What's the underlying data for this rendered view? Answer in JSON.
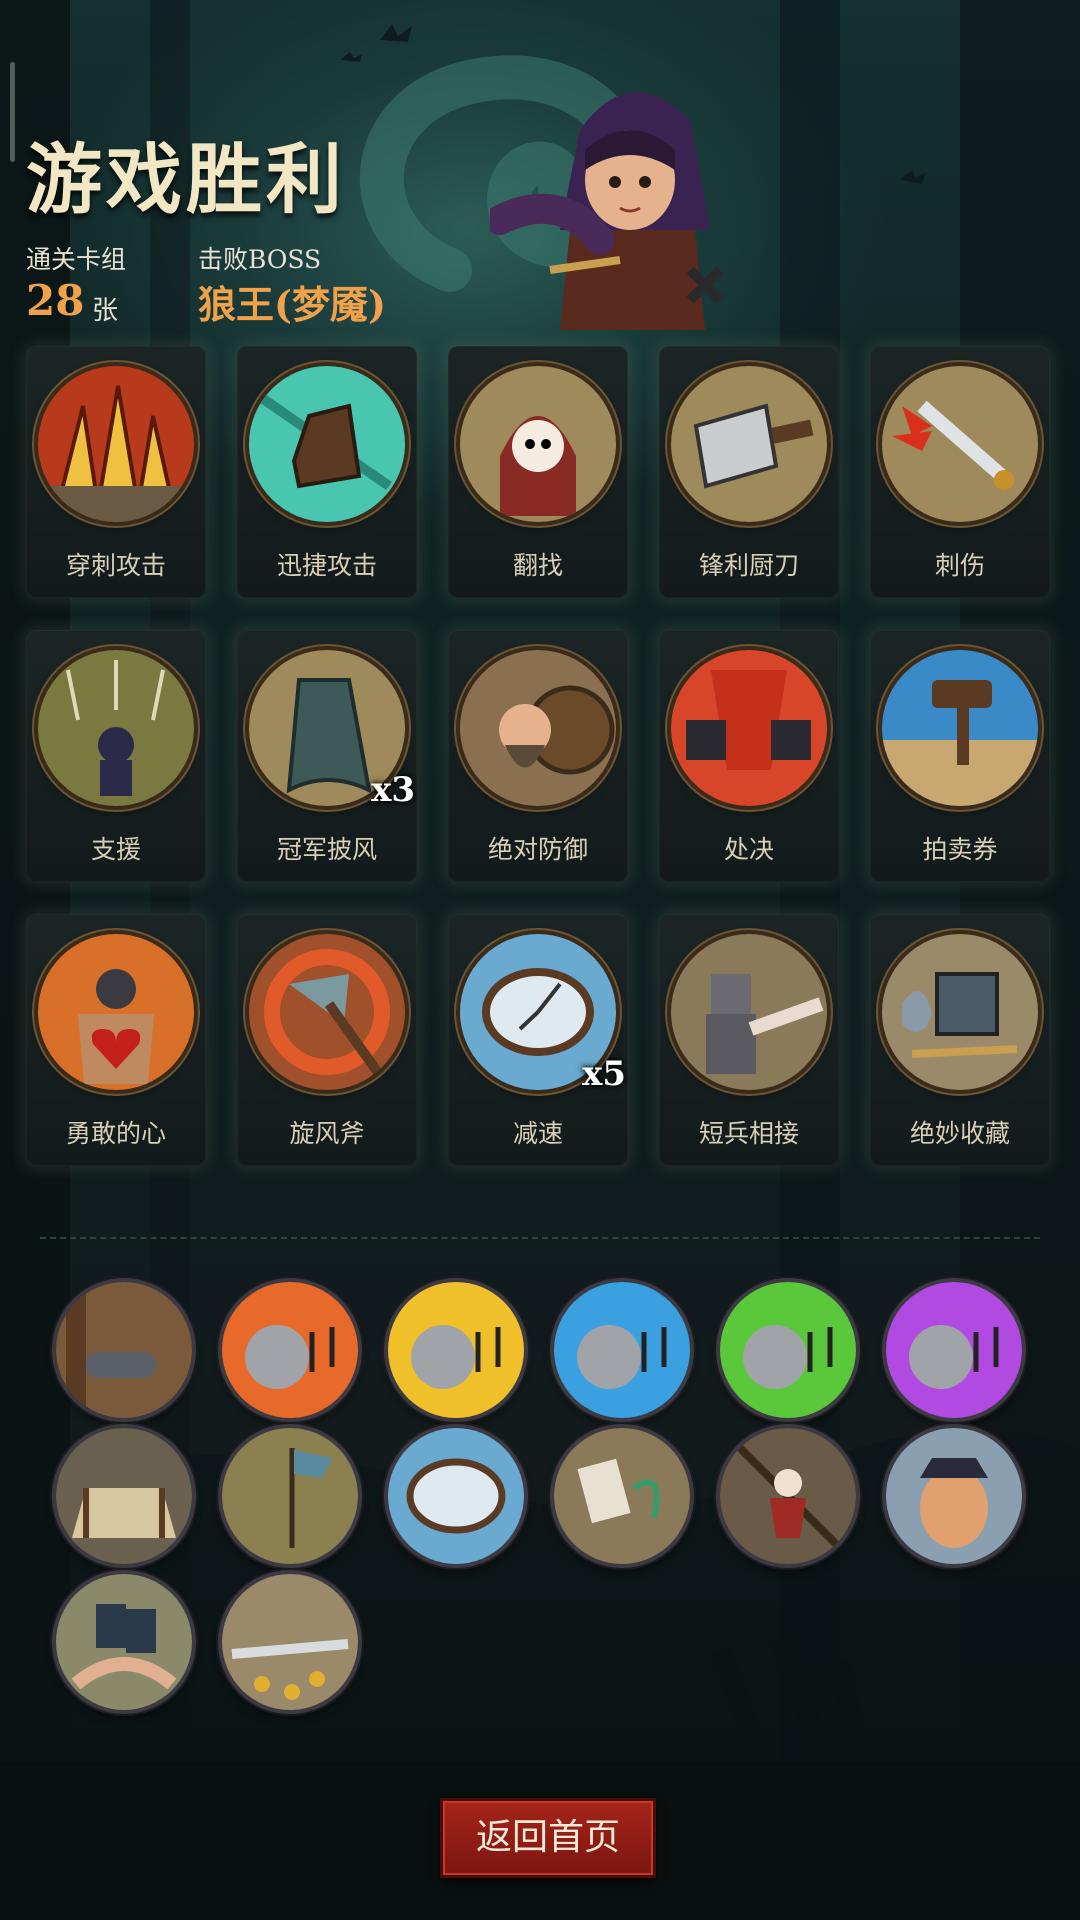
{
  "header": {
    "title": "游戏胜利",
    "cleared_deck_label": "通关卡组",
    "cleared_deck_count": "28",
    "cleared_deck_unit": "张",
    "boss_label": "击败BOSS",
    "boss_name": "狼王(梦魇)"
  },
  "cards": [
    {
      "label": "穿刺攻击",
      "icon": "spikes-icon",
      "multiplier": ""
    },
    {
      "label": "迅捷攻击",
      "icon": "swift-boot-icon",
      "multiplier": ""
    },
    {
      "label": "翻找",
      "icon": "red-hood-girl-icon",
      "multiplier": ""
    },
    {
      "label": "锋利厨刀",
      "icon": "cleaver-icon",
      "multiplier": ""
    },
    {
      "label": "刺伤",
      "icon": "dagger-stab-icon",
      "multiplier": ""
    },
    {
      "label": "支援",
      "icon": "support-arrows-icon",
      "multiplier": ""
    },
    {
      "label": "冠军披风",
      "icon": "champion-cloak-icon",
      "multiplier": "x3"
    },
    {
      "label": "绝对防御",
      "icon": "dwarf-shield-icon",
      "multiplier": ""
    },
    {
      "label": "处决",
      "icon": "execution-icon",
      "multiplier": ""
    },
    {
      "label": "拍卖券",
      "icon": "auction-gavel-icon",
      "multiplier": ""
    },
    {
      "label": "勇敢的心",
      "icon": "brave-heart-icon",
      "multiplier": ""
    },
    {
      "label": "旋风斧",
      "icon": "whirlwind-axe-icon",
      "multiplier": ""
    },
    {
      "label": "减速",
      "icon": "frozen-clock-icon",
      "multiplier": "x5"
    },
    {
      "label": "短兵相接",
      "icon": "knight-sword-icon",
      "multiplier": ""
    },
    {
      "label": "绝妙收藏",
      "icon": "collection-icon",
      "multiplier": ""
    }
  ],
  "relics": [
    {
      "icon": "cannon-icon"
    },
    {
      "icon": "skull-music-red-icon"
    },
    {
      "icon": "skull-music-yellow-icon"
    },
    {
      "icon": "skull-music-blue-icon"
    },
    {
      "icon": "skull-music-green-icon"
    },
    {
      "icon": "skull-music-purple-icon"
    },
    {
      "icon": "boxing-ring-icon"
    },
    {
      "icon": "battle-banner-icon"
    },
    {
      "icon": "frozen-clock-relic-icon"
    },
    {
      "icon": "card-trick-icon"
    },
    {
      "icon": "escape-girl-icon"
    },
    {
      "icon": "scared-pirate-icon"
    },
    {
      "icon": "card-hand-icon"
    },
    {
      "icon": "coin-sword-icon"
    }
  ],
  "colors": {
    "accent": "#f0a24a",
    "title": "#f2e7c4",
    "button": "#a52419"
  },
  "footer": {
    "home_button_label": "返回首页"
  }
}
